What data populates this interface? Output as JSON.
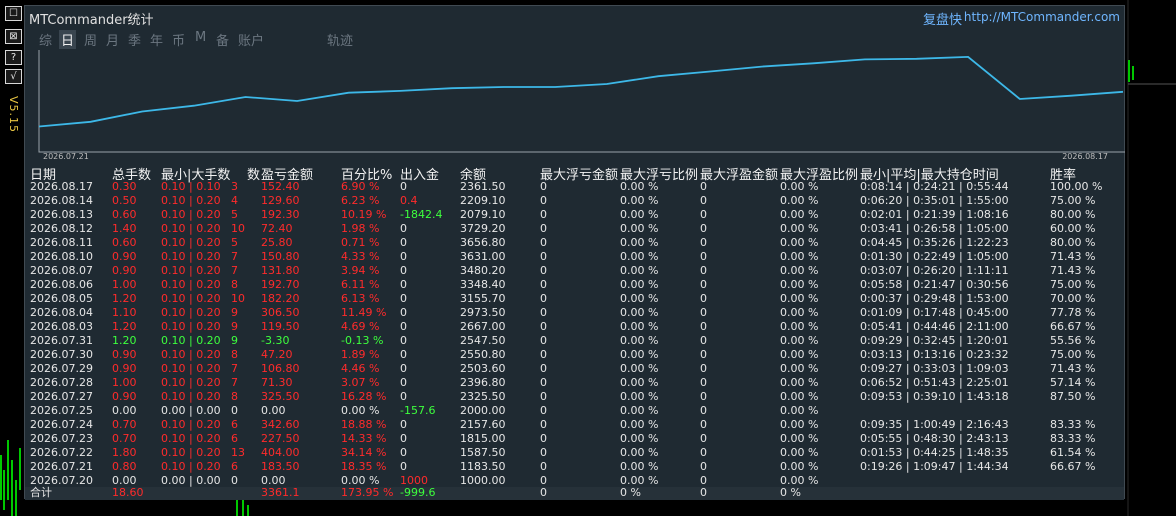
{
  "window": {
    "title": "MTCommander统计",
    "replay_label": "复盘快",
    "site_url": "http://MTCommander.com",
    "version": "V5.15"
  },
  "sidebar": {
    "buttons": [
      {
        "label": "☐",
        "icon": "window-icon"
      },
      {
        "label": "⊠",
        "icon": "collapse-icon"
      },
      {
        "label": "?",
        "icon": "help-icon"
      },
      {
        "label": "√",
        "icon": "check-icon"
      }
    ]
  },
  "tabs": [
    {
      "label": "综",
      "active": false
    },
    {
      "label": "日",
      "active": true
    },
    {
      "label": "周",
      "active": false
    },
    {
      "label": "月",
      "active": false
    },
    {
      "label": "季",
      "active": false
    },
    {
      "label": "年",
      "active": false
    },
    {
      "label": "币",
      "active": false
    },
    {
      "label": "M",
      "active": false
    },
    {
      "label": "备",
      "active": false
    },
    {
      "label": "账户",
      "active": false
    },
    {
      "label": "轨迹",
      "active": false
    }
  ],
  "curve": {
    "start_date": "2026.07.21",
    "end_date": "2026.08.17",
    "color": "#3db8e8",
    "balance_points": [
      1000,
      1183.5,
      1587.5,
      1815,
      2157.6,
      2000,
      2325.5,
      2396.8,
      2503.6,
      2550.8,
      2547.5,
      2667,
      2973.5,
      3155.7,
      3348.4,
      3480.2,
      3631,
      3656.8,
      3729.2,
      2079.1,
      2209.1,
      2361.5
    ]
  },
  "columns": [
    "日期",
    "总手数",
    "最小|大手数",
    "数",
    "盈亏金额",
    "百分比%",
    "出入金",
    "余额",
    "最大浮亏金额",
    "最大浮亏比例",
    "最大浮盈金额",
    "最大浮盈比例",
    "最小|平均|最大持仓时间",
    "胜率"
  ],
  "colors": {
    "loss": "#ff2b2b",
    "profit": "#3dff3d",
    "panel_bg": "#1f2a32",
    "link": "#6fb6ff"
  },
  "rows": [
    {
      "date": "2026.08.17",
      "tot": "0.30",
      "mm": "0.10 | 0.10",
      "cnt": "3",
      "pl": "152.40",
      "pct": "6.90 %",
      "io": "0",
      "bal": "2361.50",
      "mfl": "0",
      "mflp": "0.00 %",
      "mfp": "0",
      "mfpp": "0.00 %",
      "hold": "0:08:14 | 0:24:21 | 0:55:44",
      "win": "100.00 %",
      "pos": false,
      "io_c": "white"
    },
    {
      "date": "2026.08.14",
      "tot": "0.50",
      "mm": "0.10 | 0.20",
      "cnt": "4",
      "pl": "129.60",
      "pct": "6.23 %",
      "io": "0.4",
      "bal": "2209.10",
      "mfl": "0",
      "mflp": "0.00 %",
      "mfp": "0",
      "mfpp": "0.00 %",
      "hold": "0:06:20 | 0:35:01 | 1:55:00",
      "win": "75.00 %",
      "pos": false,
      "io_c": "red"
    },
    {
      "date": "2026.08.13",
      "tot": "0.60",
      "mm": "0.10 | 0.20",
      "cnt": "5",
      "pl": "192.30",
      "pct": "10.19 %",
      "io": "-1842.4",
      "bal": "2079.10",
      "mfl": "0",
      "mflp": "0.00 %",
      "mfp": "0",
      "mfpp": "0.00 %",
      "hold": "0:02:01 | 0:21:39 | 1:08:16",
      "win": "80.00 %",
      "pos": false,
      "io_c": "green"
    },
    {
      "date": "2026.08.12",
      "tot": "1.40",
      "mm": "0.10 | 0.20",
      "cnt": "10",
      "pl": "72.40",
      "pct": "1.98 %",
      "io": "0",
      "bal": "3729.20",
      "mfl": "0",
      "mflp": "0.00 %",
      "mfp": "0",
      "mfpp": "0.00 %",
      "hold": "0:03:41 | 0:26:58 | 1:05:00",
      "win": "60.00 %",
      "pos": false,
      "io_c": "white"
    },
    {
      "date": "2026.08.11",
      "tot": "0.60",
      "mm": "0.10 | 0.20",
      "cnt": "5",
      "pl": "25.80",
      "pct": "0.71 %",
      "io": "0",
      "bal": "3656.80",
      "mfl": "0",
      "mflp": "0.00 %",
      "mfp": "0",
      "mfpp": "0.00 %",
      "hold": "0:04:45 | 0:35:26 | 1:22:23",
      "win": "80.00 %",
      "pos": false,
      "io_c": "white"
    },
    {
      "date": "2026.08.10",
      "tot": "0.90",
      "mm": "0.10 | 0.20",
      "cnt": "7",
      "pl": "150.80",
      "pct": "4.33 %",
      "io": "0",
      "bal": "3631.00",
      "mfl": "0",
      "mflp": "0.00 %",
      "mfp": "0",
      "mfpp": "0.00 %",
      "hold": "0:01:30 | 0:22:49 | 1:05:00",
      "win": "71.43 %",
      "pos": false,
      "io_c": "white"
    },
    {
      "date": "2026.08.07",
      "tot": "0.90",
      "mm": "0.10 | 0.20",
      "cnt": "7",
      "pl": "131.80",
      "pct": "3.94 %",
      "io": "0",
      "bal": "3480.20",
      "mfl": "0",
      "mflp": "0.00 %",
      "mfp": "0",
      "mfpp": "0.00 %",
      "hold": "0:03:07 | 0:26:20 | 1:11:11",
      "win": "71.43 %",
      "pos": false,
      "io_c": "white"
    },
    {
      "date": "2026.08.06",
      "tot": "1.00",
      "mm": "0.10 | 0.20",
      "cnt": "8",
      "pl": "192.70",
      "pct": "6.11 %",
      "io": "0",
      "bal": "3348.40",
      "mfl": "0",
      "mflp": "0.00 %",
      "mfp": "0",
      "mfpp": "0.00 %",
      "hold": "0:05:58 | 0:21:47 | 0:30:56",
      "win": "75.00 %",
      "pos": false,
      "io_c": "white"
    },
    {
      "date": "2026.08.05",
      "tot": "1.20",
      "mm": "0.10 | 0.20",
      "cnt": "10",
      "pl": "182.20",
      "pct": "6.13 %",
      "io": "0",
      "bal": "3155.70",
      "mfl": "0",
      "mflp": "0.00 %",
      "mfp": "0",
      "mfpp": "0.00 %",
      "hold": "0:00:37 | 0:29:48 | 1:53:00",
      "win": "70.00 %",
      "pos": false,
      "io_c": "white"
    },
    {
      "date": "2026.08.04",
      "tot": "1.10",
      "mm": "0.10 | 0.20",
      "cnt": "9",
      "pl": "306.50",
      "pct": "11.49 %",
      "io": "0",
      "bal": "2973.50",
      "mfl": "0",
      "mflp": "0.00 %",
      "mfp": "0",
      "mfpp": "0.00 %",
      "hold": "0:01:09 | 0:17:48 | 0:45:00",
      "win": "77.78 %",
      "pos": false,
      "io_c": "white"
    },
    {
      "date": "2026.08.03",
      "tot": "1.20",
      "mm": "0.10 | 0.20",
      "cnt": "9",
      "pl": "119.50",
      "pct": "4.69 %",
      "io": "0",
      "bal": "2667.00",
      "mfl": "0",
      "mflp": "0.00 %",
      "mfp": "0",
      "mfpp": "0.00 %",
      "hold": "0:05:41 | 0:44:46 | 2:11:00",
      "win": "66.67 %",
      "pos": false,
      "io_c": "white"
    },
    {
      "date": "2026.07.31",
      "tot": "1.20",
      "mm": "0.10 | 0.20",
      "cnt": "9",
      "pl": "-3.30",
      "pct": "-0.13 %",
      "io": "0",
      "bal": "2547.50",
      "mfl": "0",
      "mflp": "0.00 %",
      "mfp": "0",
      "mfpp": "0.00 %",
      "hold": "0:09:29 | 0:32:45 | 1:20:01",
      "win": "55.56 %",
      "pos": true,
      "io_c": "white"
    },
    {
      "date": "2026.07.30",
      "tot": "0.90",
      "mm": "0.10 | 0.20",
      "cnt": "8",
      "pl": "47.20",
      "pct": "1.89 %",
      "io": "0",
      "bal": "2550.80",
      "mfl": "0",
      "mflp": "0.00 %",
      "mfp": "0",
      "mfpp": "0.00 %",
      "hold": "0:03:13 | 0:13:16 | 0:23:32",
      "win": "75.00 %",
      "pos": false,
      "io_c": "white"
    },
    {
      "date": "2026.07.29",
      "tot": "0.90",
      "mm": "0.10 | 0.20",
      "cnt": "7",
      "pl": "106.80",
      "pct": "4.46 %",
      "io": "0",
      "bal": "2503.60",
      "mfl": "0",
      "mflp": "0.00 %",
      "mfp": "0",
      "mfpp": "0.00 %",
      "hold": "0:09:27 | 0:33:03 | 1:09:03",
      "win": "71.43 %",
      "pos": false,
      "io_c": "white"
    },
    {
      "date": "2026.07.28",
      "tot": "1.00",
      "mm": "0.10 | 0.20",
      "cnt": "7",
      "pl": "71.30",
      "pct": "3.07 %",
      "io": "0",
      "bal": "2396.80",
      "mfl": "0",
      "mflp": "0.00 %",
      "mfp": "0",
      "mfpp": "0.00 %",
      "hold": "0:06:52 | 0:51:43 | 2:25:01",
      "win": "57.14 %",
      "pos": false,
      "io_c": "white"
    },
    {
      "date": "2026.07.27",
      "tot": "0.90",
      "mm": "0.10 | 0.20",
      "cnt": "8",
      "pl": "325.50",
      "pct": "16.28 %",
      "io": "0",
      "bal": "2325.50",
      "mfl": "0",
      "mflp": "0.00 %",
      "mfp": "0",
      "mfpp": "0.00 %",
      "hold": "0:09:53 | 0:39:10 | 1:43:18",
      "win": "87.50 %",
      "pos": false,
      "io_c": "white"
    },
    {
      "date": "2026.07.25",
      "tot": "0.00",
      "mm": "0.00 | 0.00",
      "cnt": "0",
      "pl": "0.00",
      "pct": "0.00 %",
      "io": "-157.6",
      "bal": "2000.00",
      "mfl": "0",
      "mflp": "0.00 %",
      "mfp": "0",
      "mfpp": "0.00 %",
      "hold": "",
      "win": "",
      "pos": null,
      "io_c": "green"
    },
    {
      "date": "2026.07.24",
      "tot": "0.70",
      "mm": "0.10 | 0.20",
      "cnt": "6",
      "pl": "342.60",
      "pct": "18.88 %",
      "io": "0",
      "bal": "2157.60",
      "mfl": "0",
      "mflp": "0.00 %",
      "mfp": "0",
      "mfpp": "0.00 %",
      "hold": "0:09:35 | 1:00:49 | 2:16:43",
      "win": "83.33 %",
      "pos": false,
      "io_c": "white"
    },
    {
      "date": "2026.07.23",
      "tot": "0.70",
      "mm": "0.10 | 0.20",
      "cnt": "6",
      "pl": "227.50",
      "pct": "14.33 %",
      "io": "0",
      "bal": "1815.00",
      "mfl": "0",
      "mflp": "0.00 %",
      "mfp": "0",
      "mfpp": "0.00 %",
      "hold": "0:05:55 | 0:48:30 | 2:43:13",
      "win": "83.33 %",
      "pos": false,
      "io_c": "white"
    },
    {
      "date": "2026.07.22",
      "tot": "1.80",
      "mm": "0.10 | 0.20",
      "cnt": "13",
      "pl": "404.00",
      "pct": "34.14 %",
      "io": "0",
      "bal": "1587.50",
      "mfl": "0",
      "mflp": "0.00 %",
      "mfp": "0",
      "mfpp": "0.00 %",
      "hold": "0:01:53 | 0:44:25 | 1:48:35",
      "win": "61.54 %",
      "pos": false,
      "io_c": "white"
    },
    {
      "date": "2026.07.21",
      "tot": "0.80",
      "mm": "0.10 | 0.20",
      "cnt": "6",
      "pl": "183.50",
      "pct": "18.35 %",
      "io": "0",
      "bal": "1183.50",
      "mfl": "0",
      "mflp": "0.00 %",
      "mfp": "0",
      "mfpp": "0.00 %",
      "hold": "0:19:26 | 1:09:47 | 1:44:34",
      "win": "66.67 %",
      "pos": false,
      "io_c": "white"
    },
    {
      "date": "2026.07.20",
      "tot": "0.00",
      "mm": "0.00 | 0.00",
      "cnt": "0",
      "pl": "0.00",
      "pct": "0.00 %",
      "io": "1000",
      "bal": "1000.00",
      "mfl": "0",
      "mflp": "0.00 %",
      "mfp": "0",
      "mfpp": "0.00 %",
      "hold": "",
      "win": "",
      "pos": null,
      "io_c": "red"
    }
  ],
  "total": {
    "label": "合计",
    "tot": "18.60",
    "pl": "3361.1",
    "pct": "173.95 %",
    "io": "-999.6",
    "mfl": "0",
    "mflp": "0 %",
    "mfp": "0",
    "mfpp": "0 %"
  }
}
